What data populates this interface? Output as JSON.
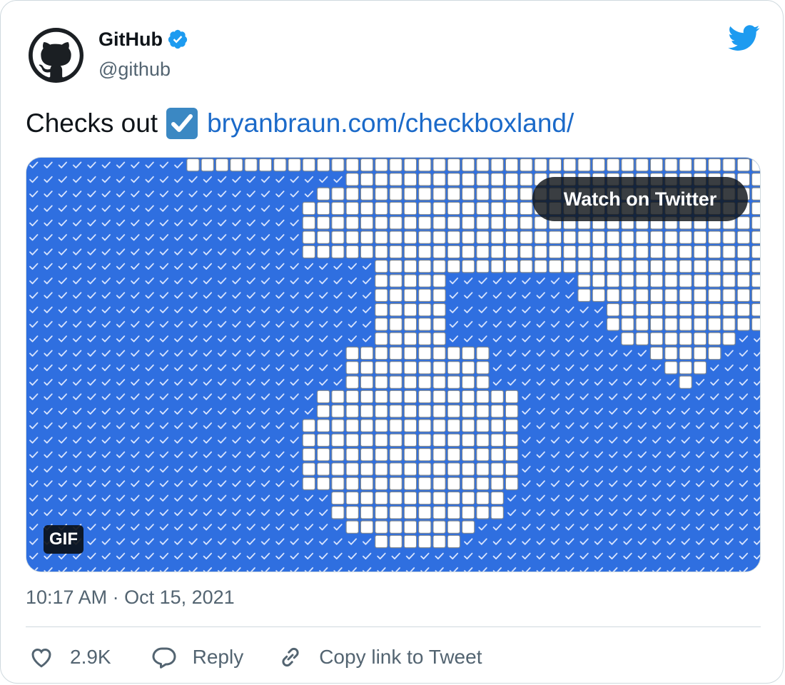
{
  "author": {
    "name": "GitHub",
    "handle": "@github",
    "verified": true,
    "avatar_icon": "github-octocat-icon"
  },
  "platform_icon": "twitter-bird-icon",
  "tweet": {
    "text": "Checks out",
    "emoji": "ballot-box-with-check",
    "link_text": "bryanbraun.com/checkboxland/"
  },
  "media": {
    "watch_label": "Watch on Twitter",
    "badge": "GIF"
  },
  "timestamp": "10:17 AM · Oct 15, 2021",
  "actions": {
    "like_count": "2.9K",
    "reply_label": "Reply",
    "copy_label": "Copy link to Tweet"
  },
  "colors": {
    "link": "#1b6ac9",
    "checked_bg": "#2f6fe0",
    "twitter_blue": "#1d9bf0",
    "secondary_text": "#536471"
  }
}
